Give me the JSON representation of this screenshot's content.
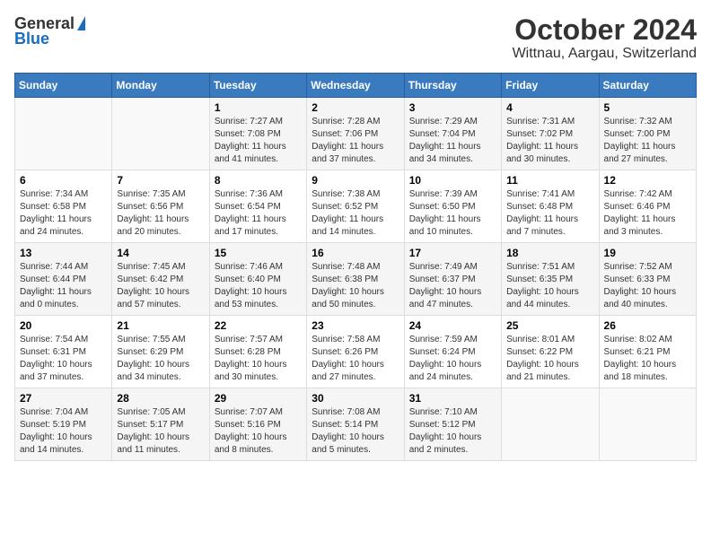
{
  "header": {
    "logo_general": "General",
    "logo_blue": "Blue",
    "title": "October 2024",
    "subtitle": "Wittnau, Aargau, Switzerland"
  },
  "calendar": {
    "days_of_week": [
      "Sunday",
      "Monday",
      "Tuesday",
      "Wednesday",
      "Thursday",
      "Friday",
      "Saturday"
    ],
    "weeks": [
      [
        {
          "day": "",
          "sunrise": "",
          "sunset": "",
          "daylight": ""
        },
        {
          "day": "",
          "sunrise": "",
          "sunset": "",
          "daylight": ""
        },
        {
          "day": "1",
          "sunrise": "Sunrise: 7:27 AM",
          "sunset": "Sunset: 7:08 PM",
          "daylight": "Daylight: 11 hours and 41 minutes."
        },
        {
          "day": "2",
          "sunrise": "Sunrise: 7:28 AM",
          "sunset": "Sunset: 7:06 PM",
          "daylight": "Daylight: 11 hours and 37 minutes."
        },
        {
          "day": "3",
          "sunrise": "Sunrise: 7:29 AM",
          "sunset": "Sunset: 7:04 PM",
          "daylight": "Daylight: 11 hours and 34 minutes."
        },
        {
          "day": "4",
          "sunrise": "Sunrise: 7:31 AM",
          "sunset": "Sunset: 7:02 PM",
          "daylight": "Daylight: 11 hours and 30 minutes."
        },
        {
          "day": "5",
          "sunrise": "Sunrise: 7:32 AM",
          "sunset": "Sunset: 7:00 PM",
          "daylight": "Daylight: 11 hours and 27 minutes."
        }
      ],
      [
        {
          "day": "6",
          "sunrise": "Sunrise: 7:34 AM",
          "sunset": "Sunset: 6:58 PM",
          "daylight": "Daylight: 11 hours and 24 minutes."
        },
        {
          "day": "7",
          "sunrise": "Sunrise: 7:35 AM",
          "sunset": "Sunset: 6:56 PM",
          "daylight": "Daylight: 11 hours and 20 minutes."
        },
        {
          "day": "8",
          "sunrise": "Sunrise: 7:36 AM",
          "sunset": "Sunset: 6:54 PM",
          "daylight": "Daylight: 11 hours and 17 minutes."
        },
        {
          "day": "9",
          "sunrise": "Sunrise: 7:38 AM",
          "sunset": "Sunset: 6:52 PM",
          "daylight": "Daylight: 11 hours and 14 minutes."
        },
        {
          "day": "10",
          "sunrise": "Sunrise: 7:39 AM",
          "sunset": "Sunset: 6:50 PM",
          "daylight": "Daylight: 11 hours and 10 minutes."
        },
        {
          "day": "11",
          "sunrise": "Sunrise: 7:41 AM",
          "sunset": "Sunset: 6:48 PM",
          "daylight": "Daylight: 11 hours and 7 minutes."
        },
        {
          "day": "12",
          "sunrise": "Sunrise: 7:42 AM",
          "sunset": "Sunset: 6:46 PM",
          "daylight": "Daylight: 11 hours and 3 minutes."
        }
      ],
      [
        {
          "day": "13",
          "sunrise": "Sunrise: 7:44 AM",
          "sunset": "Sunset: 6:44 PM",
          "daylight": "Daylight: 11 hours and 0 minutes."
        },
        {
          "day": "14",
          "sunrise": "Sunrise: 7:45 AM",
          "sunset": "Sunset: 6:42 PM",
          "daylight": "Daylight: 10 hours and 57 minutes."
        },
        {
          "day": "15",
          "sunrise": "Sunrise: 7:46 AM",
          "sunset": "Sunset: 6:40 PM",
          "daylight": "Daylight: 10 hours and 53 minutes."
        },
        {
          "day": "16",
          "sunrise": "Sunrise: 7:48 AM",
          "sunset": "Sunset: 6:38 PM",
          "daylight": "Daylight: 10 hours and 50 minutes."
        },
        {
          "day": "17",
          "sunrise": "Sunrise: 7:49 AM",
          "sunset": "Sunset: 6:37 PM",
          "daylight": "Daylight: 10 hours and 47 minutes."
        },
        {
          "day": "18",
          "sunrise": "Sunrise: 7:51 AM",
          "sunset": "Sunset: 6:35 PM",
          "daylight": "Daylight: 10 hours and 44 minutes."
        },
        {
          "day": "19",
          "sunrise": "Sunrise: 7:52 AM",
          "sunset": "Sunset: 6:33 PM",
          "daylight": "Daylight: 10 hours and 40 minutes."
        }
      ],
      [
        {
          "day": "20",
          "sunrise": "Sunrise: 7:54 AM",
          "sunset": "Sunset: 6:31 PM",
          "daylight": "Daylight: 10 hours and 37 minutes."
        },
        {
          "day": "21",
          "sunrise": "Sunrise: 7:55 AM",
          "sunset": "Sunset: 6:29 PM",
          "daylight": "Daylight: 10 hours and 34 minutes."
        },
        {
          "day": "22",
          "sunrise": "Sunrise: 7:57 AM",
          "sunset": "Sunset: 6:28 PM",
          "daylight": "Daylight: 10 hours and 30 minutes."
        },
        {
          "day": "23",
          "sunrise": "Sunrise: 7:58 AM",
          "sunset": "Sunset: 6:26 PM",
          "daylight": "Daylight: 10 hours and 27 minutes."
        },
        {
          "day": "24",
          "sunrise": "Sunrise: 7:59 AM",
          "sunset": "Sunset: 6:24 PM",
          "daylight": "Daylight: 10 hours and 24 minutes."
        },
        {
          "day": "25",
          "sunrise": "Sunrise: 8:01 AM",
          "sunset": "Sunset: 6:22 PM",
          "daylight": "Daylight: 10 hours and 21 minutes."
        },
        {
          "day": "26",
          "sunrise": "Sunrise: 8:02 AM",
          "sunset": "Sunset: 6:21 PM",
          "daylight": "Daylight: 10 hours and 18 minutes."
        }
      ],
      [
        {
          "day": "27",
          "sunrise": "Sunrise: 7:04 AM",
          "sunset": "Sunset: 5:19 PM",
          "daylight": "Daylight: 10 hours and 14 minutes."
        },
        {
          "day": "28",
          "sunrise": "Sunrise: 7:05 AM",
          "sunset": "Sunset: 5:17 PM",
          "daylight": "Daylight: 10 hours and 11 minutes."
        },
        {
          "day": "29",
          "sunrise": "Sunrise: 7:07 AM",
          "sunset": "Sunset: 5:16 PM",
          "daylight": "Daylight: 10 hours and 8 minutes."
        },
        {
          "day": "30",
          "sunrise": "Sunrise: 7:08 AM",
          "sunset": "Sunset: 5:14 PM",
          "daylight": "Daylight: 10 hours and 5 minutes."
        },
        {
          "day": "31",
          "sunrise": "Sunrise: 7:10 AM",
          "sunset": "Sunset: 5:12 PM",
          "daylight": "Daylight: 10 hours and 2 minutes."
        },
        {
          "day": "",
          "sunrise": "",
          "sunset": "",
          "daylight": ""
        },
        {
          "day": "",
          "sunrise": "",
          "sunset": "",
          "daylight": ""
        }
      ]
    ]
  }
}
